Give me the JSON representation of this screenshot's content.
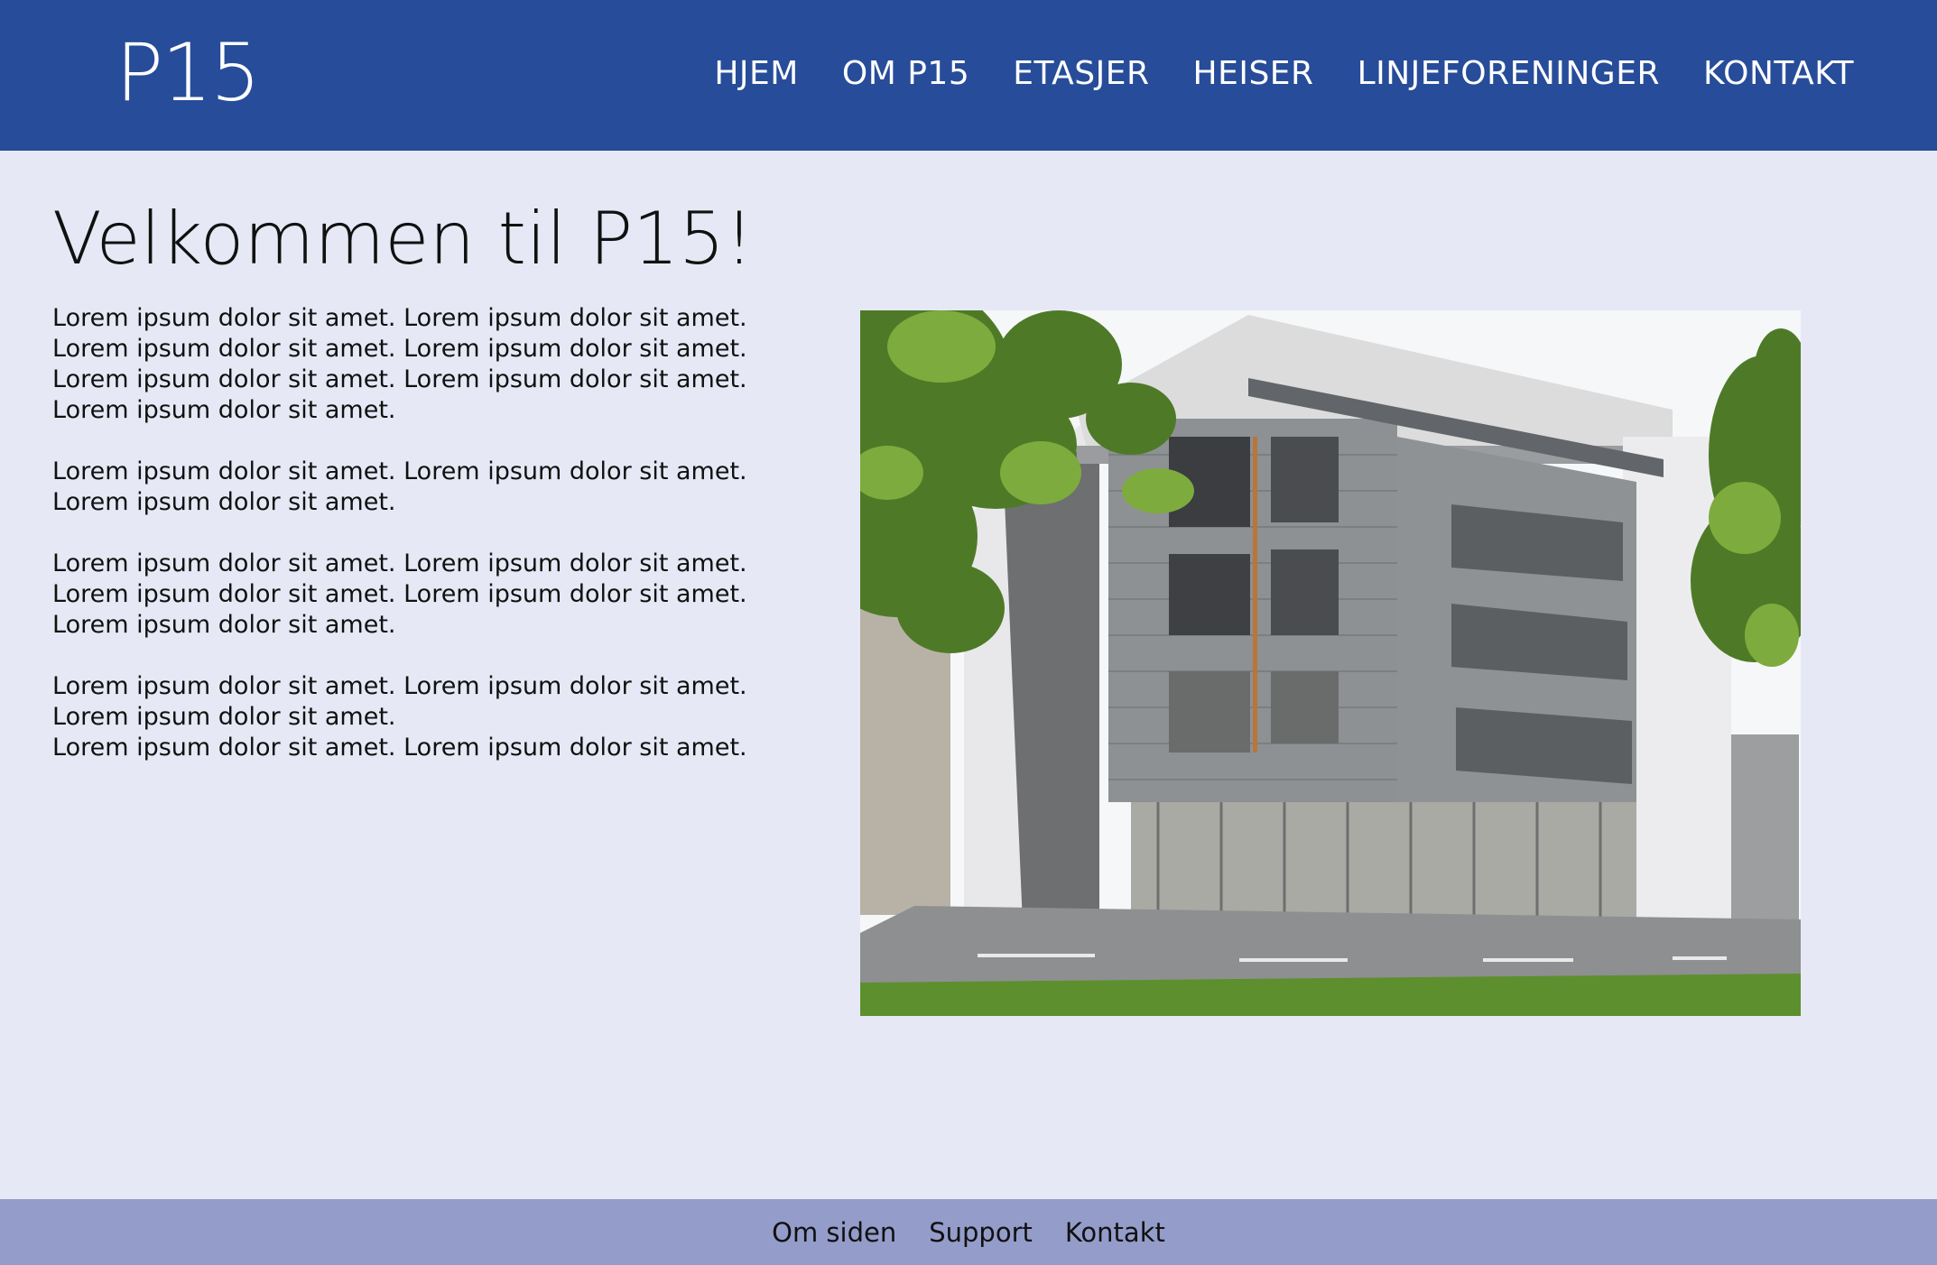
{
  "header": {
    "logo": "P15",
    "nav": [
      {
        "label": "HJEM"
      },
      {
        "label": "OM P15"
      },
      {
        "label": "ETASJER"
      },
      {
        "label": "HEISER"
      },
      {
        "label": "LINJEFORENINGER"
      },
      {
        "label": "KONTAKT"
      }
    ]
  },
  "main": {
    "title": "Velkommen til P15!",
    "paragraphs": [
      "Lorem ipsum dolor sit amet. Lorem ipsum dolor sit amet. Lorem ipsum dolor sit amet. Lorem ipsum dolor sit amet. Lorem ipsum dolor sit amet. Lorem ipsum dolor sit amet. Lorem ipsum dolor sit amet.",
      "Lorem ipsum dolor sit amet. Lorem ipsum dolor sit amet. Lorem ipsum dolor sit amet.",
      "Lorem ipsum dolor sit amet. Lorem ipsum dolor sit amet. Lorem ipsum dolor sit amet. Lorem ipsum dolor sit amet. Lorem ipsum dolor sit amet.",
      "Lorem ipsum dolor sit amet. Lorem ipsum dolor sit amet. Lorem ipsum dolor sit amet.",
      "Lorem ipsum dolor sit amet. Lorem ipsum dolor sit amet."
    ]
  },
  "footer": {
    "links": [
      {
        "label": "Om siden"
      },
      {
        "label": "Support"
      },
      {
        "label": "Kontakt"
      }
    ]
  },
  "colors": {
    "header_bg": "#274c99",
    "page_bg": "#e6e9f5",
    "footer_bg": "#949cca"
  }
}
